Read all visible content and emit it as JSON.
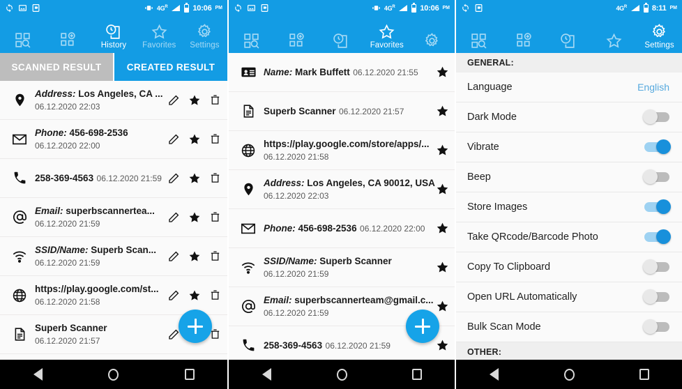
{
  "colors": {
    "brand_blue": "#139CE4",
    "fab_blue": "#16A3E8",
    "tab_inactive_gray": "#BDBDBD",
    "link_blue": "#56A9DE",
    "toggle_on": "#1890DB",
    "toggle_off": "#E8E8E8",
    "list_bg": "#FAFAFA"
  },
  "nav": {
    "items": [
      {
        "label": "",
        "icon": "scan-qr-icon",
        "name": "scan"
      },
      {
        "label": "",
        "icon": "create-qr-icon",
        "name": "create"
      },
      {
        "label": "History",
        "icon": "history-icon",
        "name": "history"
      },
      {
        "label": "Favorites",
        "icon": "star-icon",
        "name": "favorites"
      },
      {
        "label": "Settings",
        "icon": "gear-icon",
        "name": "settings"
      }
    ]
  },
  "panels": [
    {
      "id": "history",
      "status_bar": {
        "time": "10:06",
        "meridiem": "PM",
        "network": "4G",
        "roaming": "R",
        "icons": [
          "sync-icon",
          "image-icon",
          "screenshot-icon"
        ]
      },
      "active_nav": 2,
      "nav_label": "History",
      "tabs": [
        {
          "label": "SCANNED RESULT",
          "active": false
        },
        {
          "label": "CREATED RESULT",
          "active": true
        }
      ],
      "rows": [
        {
          "icon": "location-pin-icon",
          "prefix": "Address:",
          "title": " Los Angeles, CA ...",
          "date": "06.12.2020 22:03"
        },
        {
          "icon": "envelope-icon",
          "prefix": "Phone:",
          "title": " 456-698-2536",
          "date": "06.12.2020 22:00"
        },
        {
          "icon": "phone-icon",
          "prefix": "",
          "title": "258-369-4563",
          "date": "06.12.2020 21:59"
        },
        {
          "icon": "at-sign-icon",
          "prefix": "Email:",
          "title": " superbscannertea...",
          "date": "06.12.2020 21:59"
        },
        {
          "icon": "wifi-icon",
          "prefix": "SSID/Name:",
          "title": " Superb Scan...",
          "date": "06.12.2020 21:59"
        },
        {
          "icon": "globe-icon",
          "prefix": "",
          "title": "https://play.google.com/st...",
          "date": "06.12.2020 21:58"
        },
        {
          "icon": "document-icon",
          "prefix": "",
          "title": "Superb Scanner",
          "date": "06.12.2020 21:57"
        }
      ],
      "row_actions": [
        "edit-pencil-icon",
        "star-filled-icon",
        "trash-icon"
      ],
      "fab": "add-button"
    },
    {
      "id": "favorites",
      "status_bar": {
        "time": "10:06",
        "meridiem": "PM",
        "network": "4G",
        "roaming": "R",
        "icons": [
          "sync-icon",
          "image-icon",
          "screenshot-icon"
        ]
      },
      "active_nav": 3,
      "nav_label": "Favorites",
      "rows": [
        {
          "icon": "contact-card-icon",
          "prefix": "Name:",
          "title": " Mark Buffett",
          "date": "06.12.2020 21:55"
        },
        {
          "icon": "document-icon",
          "prefix": "",
          "title": "Superb Scanner",
          "date": "06.12.2020 21:57"
        },
        {
          "icon": "globe-icon",
          "prefix": "",
          "title": "https://play.google.com/store/apps/...",
          "date": "06.12.2020 21:58"
        },
        {
          "icon": "location-pin-icon",
          "prefix": "Address:",
          "title": " Los Angeles, CA 90012, USA",
          "date": "06.12.2020 22:03"
        },
        {
          "icon": "envelope-icon",
          "prefix": "Phone:",
          "title": " 456-698-2536",
          "date": "06.12.2020 22:00"
        },
        {
          "icon": "wifi-icon",
          "prefix": "SSID/Name:",
          "title": " Superb Scanner",
          "date": "06.12.2020 21:59"
        },
        {
          "icon": "at-sign-icon",
          "prefix": "Email:",
          "title": " superbscannerteam@gmail.c...",
          "date": "06.12.2020 21:59"
        },
        {
          "icon": "phone-icon",
          "prefix": "",
          "title": "258-369-4563",
          "date": "06.12.2020 21:59"
        }
      ],
      "row_actions": [
        "star-filled-icon"
      ],
      "fab": "add-button"
    },
    {
      "id": "settings",
      "status_bar": {
        "time": "8:11",
        "meridiem": "PM",
        "network": "4G",
        "roaming": "R",
        "icons": [
          "sync-icon",
          "screenshot-icon"
        ]
      },
      "active_nav": 4,
      "nav_label": "Settings",
      "sections": [
        {
          "heading": "GENERAL:",
          "rows": [
            {
              "label": "Language",
              "type": "value",
              "value": "English"
            },
            {
              "label": "Dark Mode",
              "type": "toggle",
              "on": false
            },
            {
              "label": "Vibrate",
              "type": "toggle",
              "on": true
            },
            {
              "label": "Beep",
              "type": "toggle",
              "on": false
            },
            {
              "label": "Store Images",
              "type": "toggle",
              "on": true
            },
            {
              "label": "Take QRcode/Barcode Photo",
              "type": "toggle",
              "on": true
            },
            {
              "label": "Copy To Clipboard",
              "type": "toggle",
              "on": false
            },
            {
              "label": "Open URL Automatically",
              "type": "toggle",
              "on": false
            },
            {
              "label": "Bulk Scan Mode",
              "type": "toggle",
              "on": false
            }
          ]
        },
        {
          "heading": "OTHER:",
          "rows": []
        }
      ]
    }
  ],
  "sysnav": {
    "back": "back-triangle-icon",
    "home": "home-circle-icon",
    "recents": "recents-square-icon"
  }
}
